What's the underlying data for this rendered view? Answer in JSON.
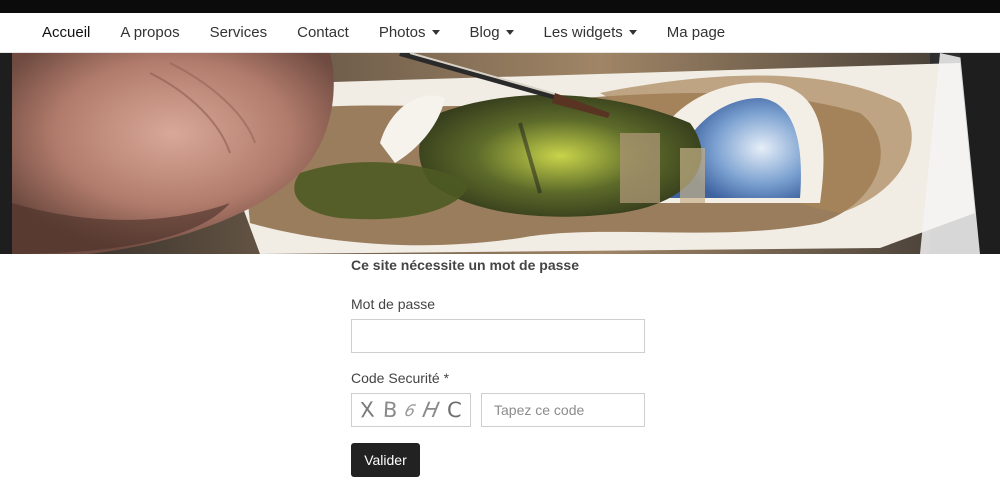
{
  "nav": {
    "items": [
      {
        "label": "Accueil",
        "active": true,
        "has_dropdown": false
      },
      {
        "label": "A propos",
        "active": false,
        "has_dropdown": false
      },
      {
        "label": "Services",
        "active": false,
        "has_dropdown": false
      },
      {
        "label": "Contact",
        "active": false,
        "has_dropdown": false
      },
      {
        "label": "Photos",
        "active": false,
        "has_dropdown": true
      },
      {
        "label": "Blog",
        "active": false,
        "has_dropdown": true
      },
      {
        "label": "Les widgets",
        "active": false,
        "has_dropdown": true
      },
      {
        "label": "Ma page",
        "active": false,
        "has_dropdown": false
      }
    ]
  },
  "hero": {
    "icon": "watercolor-painting-banner"
  },
  "form": {
    "title": "Ce site nécessite un mot de passe",
    "password_label": "Mot de passe",
    "password_value": "",
    "code_label": "Code Securité *",
    "captcha_chars": [
      "X",
      "B",
      "6",
      "H",
      "C"
    ],
    "code_placeholder": "Tapez ce code",
    "code_value": "",
    "submit_label": "Valider"
  },
  "colors": {
    "topbar": "#0b0b0b",
    "button_bg": "#222222",
    "button_text": "#ffffff"
  }
}
